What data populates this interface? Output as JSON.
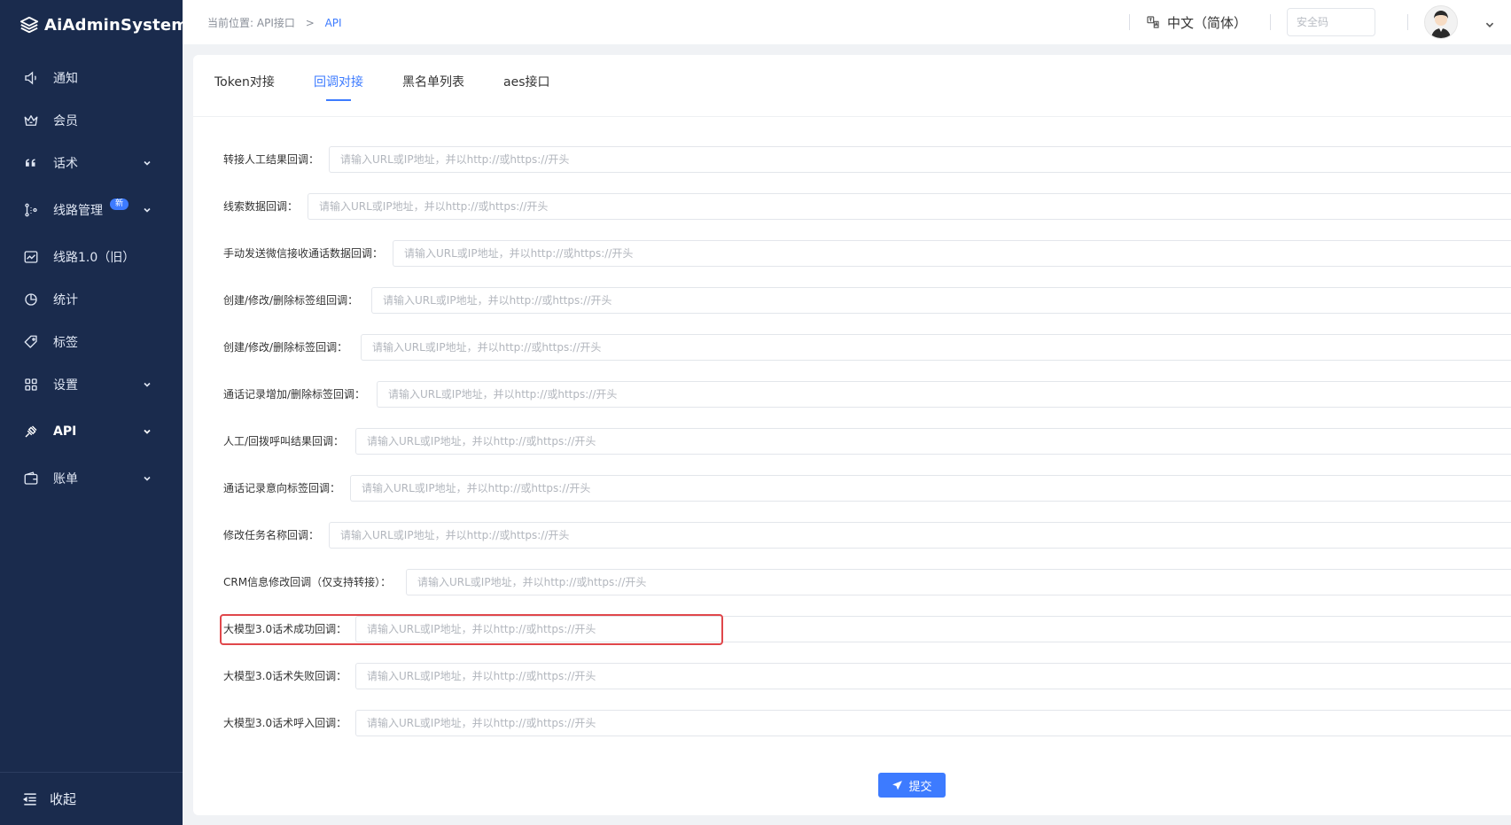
{
  "app": {
    "title": "AiAdminSystem"
  },
  "sidebar": {
    "items": [
      {
        "label": "通知",
        "icon": "speaker-icon",
        "has_chevron": false
      },
      {
        "label": "会员",
        "icon": "crown-icon",
        "has_chevron": false
      },
      {
        "label": "话术",
        "icon": "quote-icon",
        "has_chevron": true
      },
      {
        "label": "线路管理",
        "icon": "route-icon",
        "has_chevron": true,
        "badge": "新"
      },
      {
        "label": "线路1.0（旧）",
        "icon": "chart-board-icon",
        "has_chevron": false
      },
      {
        "label": "统计",
        "icon": "pie-chart-icon",
        "has_chevron": false
      },
      {
        "label": "标签",
        "icon": "tag-icon",
        "has_chevron": false
      },
      {
        "label": "设置",
        "icon": "grid-icon",
        "has_chevron": true
      },
      {
        "label": "API",
        "icon": "plug-icon",
        "has_chevron": true,
        "active": true
      },
      {
        "label": "账单",
        "icon": "wallet-icon",
        "has_chevron": true
      }
    ],
    "collapse_label": "收起"
  },
  "header": {
    "breadcrumb_prefix": "当前位置:",
    "breadcrumb_parent": "API接口",
    "breadcrumb_separator": ">",
    "breadcrumb_current": "API",
    "language": "中文（简体）",
    "security_code_placeholder": "安全码"
  },
  "tabs": [
    {
      "label": "Token对接",
      "active": false
    },
    {
      "label": "回调对接",
      "active": true
    },
    {
      "label": "黑名单列表",
      "active": false
    },
    {
      "label": "aes接口",
      "active": false
    }
  ],
  "form": {
    "input_placeholder": "请输入URL或IP地址，并以http://或https://开头",
    "fields": [
      {
        "label": "转接人工结果回调：",
        "value": ""
      },
      {
        "label": "线索数据回调：",
        "value": ""
      },
      {
        "label": "手动发送微信接收通话数据回调：",
        "value": ""
      },
      {
        "label": "创建/修改/删除标签组回调：",
        "value": ""
      },
      {
        "label": "创建/修改/删除标签回调：",
        "value": ""
      },
      {
        "label": "通话记录增加/删除标签回调：",
        "value": ""
      },
      {
        "label": "人工/回拨呼叫结果回调：",
        "value": ""
      },
      {
        "label": "通话记录意向标签回调：",
        "value": ""
      },
      {
        "label": "修改任务名称回调：",
        "value": ""
      },
      {
        "label": "CRM信息修改回调（仅支持转接）：",
        "value": ""
      },
      {
        "label": "大模型3.0话术成功回调：",
        "value": "",
        "highlighted": true
      },
      {
        "label": "大模型3.0话术失败回调：",
        "value": ""
      },
      {
        "label": "大模型3.0话术呼入回调：",
        "value": ""
      }
    ],
    "submit_label": "提交"
  },
  "colors": {
    "sidebar_bg": "#1a2b4d",
    "accent": "#3d7bff",
    "highlight": "#e0474b"
  }
}
